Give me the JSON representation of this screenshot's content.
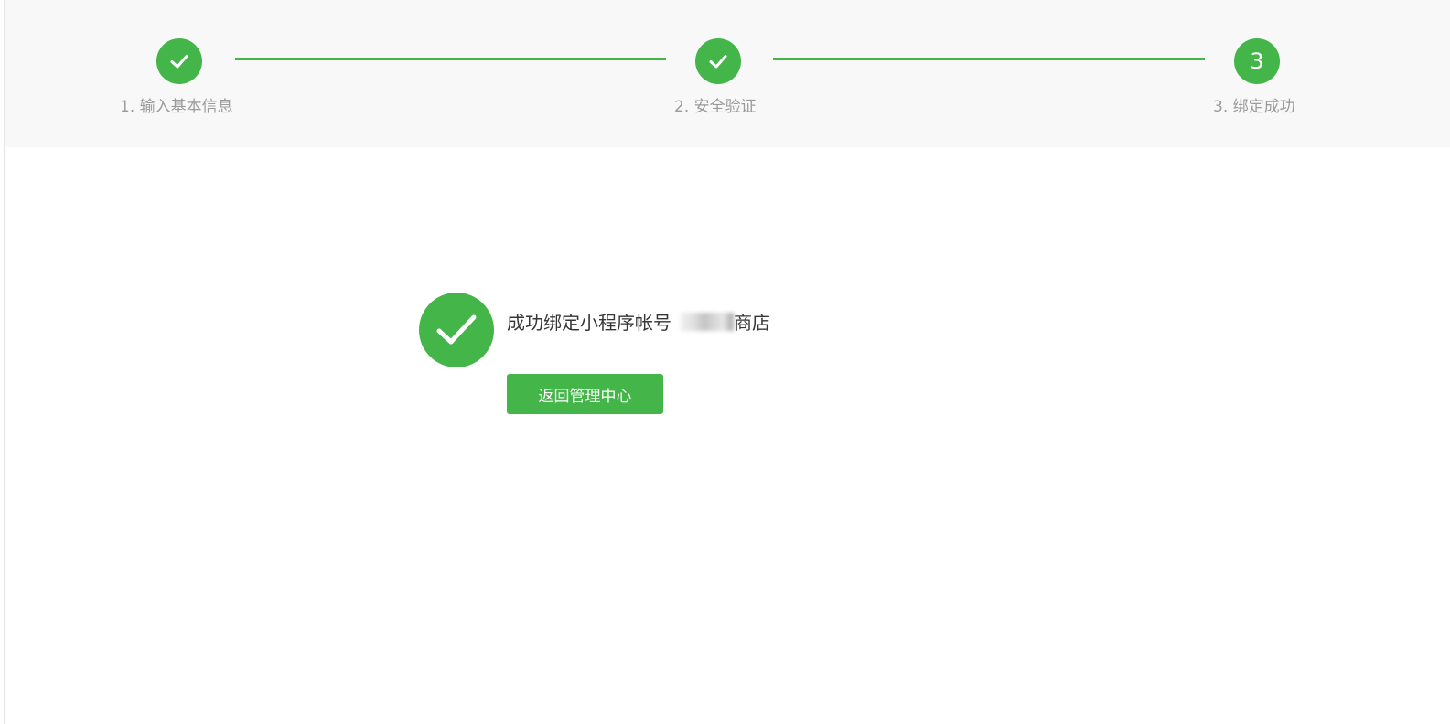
{
  "steps": [
    {
      "label": "1. 输入基本信息",
      "state": "done",
      "icon": "check-icon"
    },
    {
      "label": "2. 安全验证",
      "state": "done",
      "icon": "check-icon"
    },
    {
      "label": "3. 绑定成功",
      "state": "current",
      "number": "3"
    }
  ],
  "result": {
    "icon": "success-check-icon",
    "message_prefix": "成功绑定小程序帐号",
    "account_name": "",
    "message_suffix": "商店",
    "back_button_label": "返回管理中心"
  },
  "colors": {
    "accent": "#44b549",
    "stepper_background": "#f8f8f8",
    "label_gray": "#9a9a9a",
    "text_dark": "#353535"
  }
}
